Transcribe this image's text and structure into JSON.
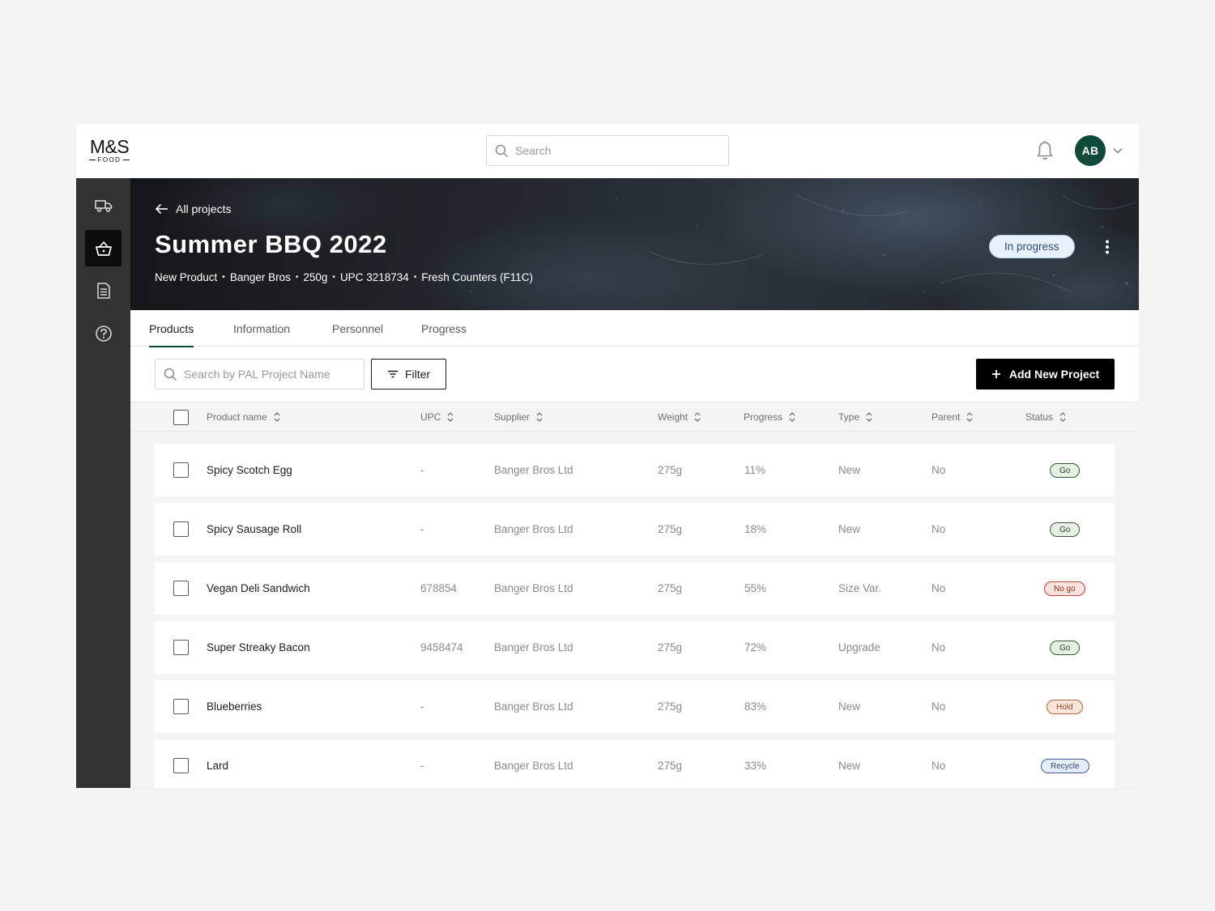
{
  "brand": {
    "logo_main": "M&S",
    "logo_sub": "FOOD"
  },
  "topbar": {
    "search_placeholder": "Search",
    "avatar_initials": "AB"
  },
  "sidebar": {
    "items": [
      {
        "icon": "truck-icon",
        "active": false
      },
      {
        "icon": "basket-icon",
        "active": true
      },
      {
        "icon": "document-icon",
        "active": false
      },
      {
        "icon": "help-icon",
        "active": false
      }
    ]
  },
  "project": {
    "back_label": "All projects",
    "title": "Summer BBQ 2022",
    "meta": [
      "New Product",
      "Banger Bros",
      "250g",
      "UPC 3218734",
      "Fresh Counters (F11C)"
    ],
    "meta_separator": "•",
    "status": "In progress"
  },
  "tabs": [
    {
      "label": "Products",
      "active": true
    },
    {
      "label": "Information",
      "active": false
    },
    {
      "label": "Personnel",
      "active": false
    },
    {
      "label": "Progress",
      "active": false
    }
  ],
  "toolbar": {
    "search_placeholder": "Search by PAL Project Name",
    "filter_label": "Filter",
    "add_label": "Add New Project"
  },
  "table": {
    "columns": [
      "Product name",
      "UPC",
      "Supplier",
      "Weight",
      "Progress",
      "Type",
      "Parent",
      "Status"
    ],
    "rows": [
      {
        "name": "Spicy Scotch Egg",
        "upc": "-",
        "supplier": "Banger Bros Ltd",
        "weight": "275g",
        "progress": "11%",
        "type": "New",
        "parent": "No",
        "status": "Go",
        "status_kind": "go"
      },
      {
        "name": "Spicy Sausage Roll",
        "upc": "-",
        "supplier": "Banger Bros Ltd",
        "weight": "275g",
        "progress": "18%",
        "type": "New",
        "parent": "No",
        "status": "Go",
        "status_kind": "go"
      },
      {
        "name": "Vegan Deli Sandwich",
        "upc": "678854",
        "supplier": "Banger Bros Ltd",
        "weight": "275g",
        "progress": "55%",
        "type": "Size Var.",
        "parent": "No",
        "status": "No go",
        "status_kind": "nogo"
      },
      {
        "name": "Super Streaky Bacon",
        "upc": "9458474",
        "supplier": "Banger Bros Ltd",
        "weight": "275g",
        "progress": "72%",
        "type": "Upgrade",
        "parent": "No",
        "status": "Go",
        "status_kind": "go"
      },
      {
        "name": "Blueberries",
        "upc": "-",
        "supplier": "Banger Bros Ltd",
        "weight": "275g",
        "progress": "83%",
        "type": "New",
        "parent": "No",
        "status": "Hold",
        "status_kind": "hold"
      },
      {
        "name": "Lard",
        "upc": "-",
        "supplier": "Banger Bros Ltd",
        "weight": "275g",
        "progress": "33%",
        "type": "New",
        "parent": "No",
        "status": "Recycle",
        "status_kind": "recycle"
      }
    ]
  },
  "colors": {
    "brand_green": "#104a3a",
    "sidebar_bg": "#323232",
    "status_go": "#385a39",
    "status_nogo": "#b8443a",
    "status_hold": "#b8613a",
    "status_recycle": "#3d5f94"
  }
}
